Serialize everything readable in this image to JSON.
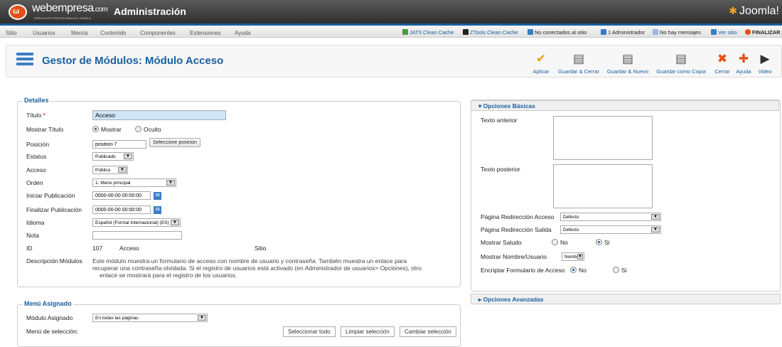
{
  "header": {
    "brand": "webempresa",
    "brand_suffix": ".com",
    "brand_sub": "SERVICIOS PROFESIONALES JOOMLA",
    "title": "Administración",
    "joomla": "Joomla!"
  },
  "menu": [
    "Sitio",
    "Usuarios",
    "Menús",
    "Contenido",
    "Componentes",
    "Extensiones",
    "Ayuda"
  ],
  "status": {
    "jat3": "JAT3 Clean Cache",
    "ztools": "ZTools Clean Cache",
    "not_connected": "No conectados al sitio",
    "admins": "1 Administrador",
    "messages": "No hay mensajes",
    "view_site": "Ver sitio",
    "finish": "FINALIZAR"
  },
  "page": {
    "title": "Gestor de Módulos: Módulo Acceso"
  },
  "toolbar": {
    "apply": "Aplicar",
    "save_close": "Guardar & Cerrar",
    "save_new": "Guardar & Nuevo",
    "save_copy": "Guardar como Copia",
    "close": "Cerrar",
    "help": "Ayuda",
    "video": "Video"
  },
  "details": {
    "legend": "Detalles",
    "title_label": "Título",
    "title_value": "Acceso",
    "show_title_label": "Mostrar Título",
    "show": "Mostrar",
    "hide": "Oculto",
    "position_label": "Posición",
    "position_value": "position-7",
    "position_btn": "Seleccione posicion",
    "status_label": "Estatus",
    "status_value": "Publicado",
    "access_label": "Acceso",
    "access_value": "Público",
    "order_label": "Orden",
    "order_value": "1. Menú principal",
    "start_label": "Iniciar Publicación",
    "start_value": "0000-00-00 00:00:00",
    "finish_label": "Finalizar Publicación",
    "finish_value": "0000-00-00 00:00:00",
    "lang_label": "Idioma",
    "lang_value": "Español (Formal Internacional) (ES)",
    "note_label": "Nota",
    "id_label": "ID",
    "id_value": "107",
    "id_type": "Acceso",
    "id_site": "Sitio",
    "desc_label": "Descripción Módulos",
    "desc_1": "Este módulo muestra un formulario de acceso con nombre de usuario y contraseña. También muestra un enlace para",
    "desc_2": "recuperar una contraseña olvidada. Si el registro de usuarios está activado (en Administrador de usuarios> Opciones), otro",
    "desc_3": "enlace se mostrará para el registro de los usuarios."
  },
  "assign": {
    "legend": "Menú Asignado",
    "module_label": "Módulo Asignado",
    "module_value": "En todas las páginas.",
    "select_label": "Menú de selección:",
    "sel_all": "Seleccionar todo",
    "clear": "Limpiar selección",
    "toggle": "Cambiar selección"
  },
  "basic": {
    "head": "Opciones Básicas",
    "pre_text": "Texto anterior",
    "post_text": "Texto posterior",
    "login_redirect": "Página Redirección Acceso",
    "login_redirect_value": "Defecto",
    "logout_redirect": "Página Redirección Salida",
    "logout_redirect_value": "Defecto",
    "greeting": "Mostrar Saludo",
    "no": "No",
    "yes": "Si",
    "name_user": "Mostrar Nombre/Usuario",
    "name_user_value": "Nombre",
    "encrypt": "Encriptar Formulario de Acceso"
  },
  "advanced": {
    "head": "Opciones Avanzadas"
  }
}
